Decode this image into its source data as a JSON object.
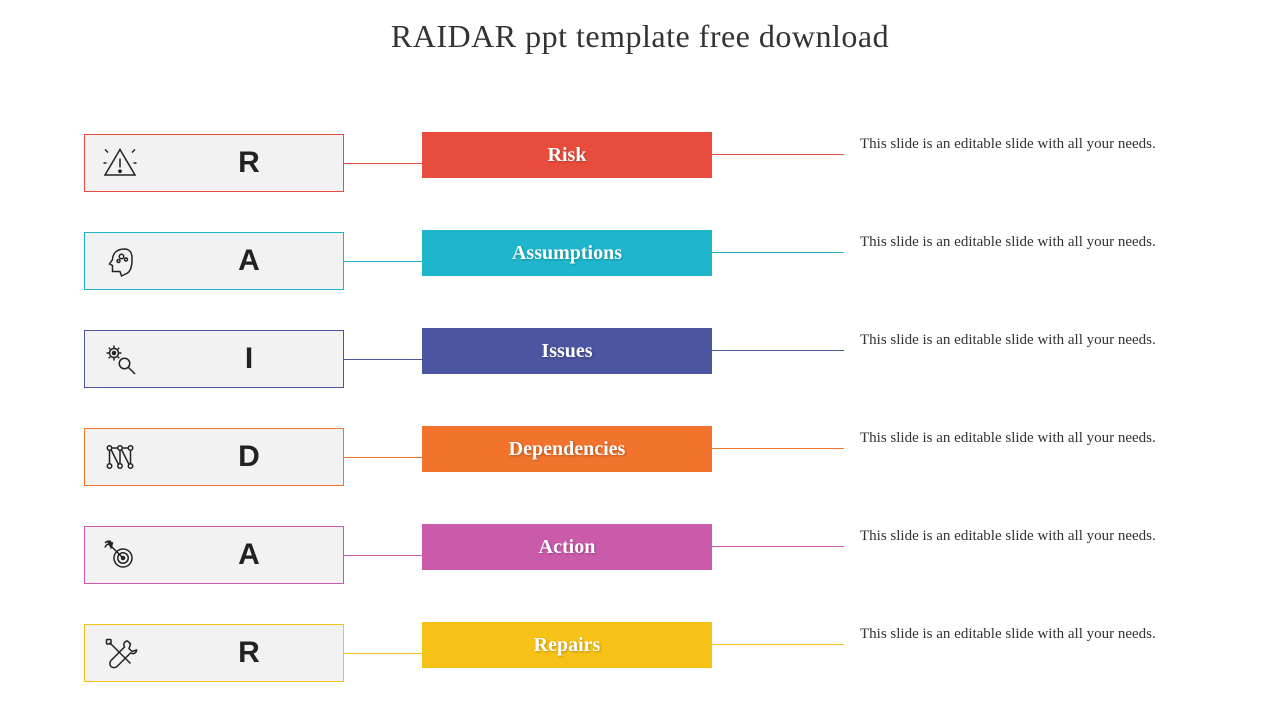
{
  "title": "RAIDAR ppt template free download",
  "rows": [
    {
      "letter": "R",
      "label": "Risk",
      "color": "#e74c3c",
      "icon": "warning",
      "desc": "This slide is an editable slide with all your needs."
    },
    {
      "letter": "A",
      "label": "Assumptions",
      "color": "#1fb6cd",
      "icon": "head",
      "desc": "This slide is an editable slide with all your needs."
    },
    {
      "letter": "I",
      "label": "Issues",
      "color": "#4c55a0",
      "icon": "gears",
      "desc": "This slide is an editable slide with all your needs."
    },
    {
      "letter": "D",
      "label": "Dependencies",
      "color": "#f1732c",
      "icon": "network",
      "desc": "This slide is an editable slide with all your needs."
    },
    {
      "letter": "A",
      "label": "Action",
      "color": "#c95baa",
      "icon": "target",
      "desc": "This slide is an editable slide with all your needs."
    },
    {
      "letter": "R",
      "label": "Repairs",
      "color": "#f6c216",
      "icon": "tools",
      "desc": "This slide is an editable slide with all your needs."
    }
  ]
}
